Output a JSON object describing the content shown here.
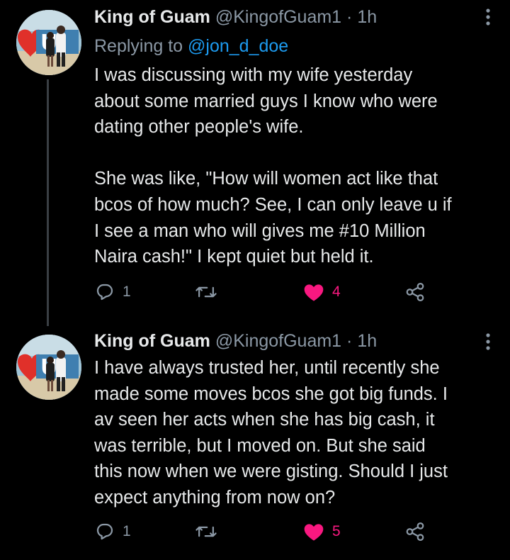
{
  "tweets": [
    {
      "display_name": "King of Guam",
      "handle": "@KingofGuam1",
      "separator": "·",
      "time": "1h",
      "replying_prefix": "Replying to ",
      "replying_to": "@jon_d_doe",
      "text": "I was discussing with my wife yesterday\nabout some married guys I know who were\ndating other people's wife.\n\nShe was like, \"How will women act like that\nbcos of how much? See, I can only leave u if\nI see a man who will gives me #10 Million\nNaira cash!\" I kept quiet but held it.",
      "reply_count": "1",
      "retweet_count": "",
      "like_count": "4",
      "liked": true
    },
    {
      "display_name": "King of Guam",
      "handle": "@KingofGuam1",
      "separator": "·",
      "time": "1h",
      "text": "I have always trusted her, until recently she\nmade some moves bcos she got big funds. I\nav seen her acts when she has big cash, it\nwas terrible, but I moved on. But she said\nthis now when we were gisting. Should I just\nexpect anything from now on?",
      "reply_count": "1",
      "retweet_count": "",
      "like_count": "5",
      "liked": true
    }
  ],
  "icons": {
    "reply": "reply-icon",
    "retweet": "retweet-icon",
    "like": "heart-filled-icon",
    "share": "share-icon",
    "more": "more-vertical-icon"
  },
  "colors": {
    "background": "#000000",
    "text": "#e7e9ea",
    "secondary": "#8b98a5",
    "link": "#1d9bf0",
    "like": "#f91880",
    "thread_line": "#3a3f44"
  }
}
